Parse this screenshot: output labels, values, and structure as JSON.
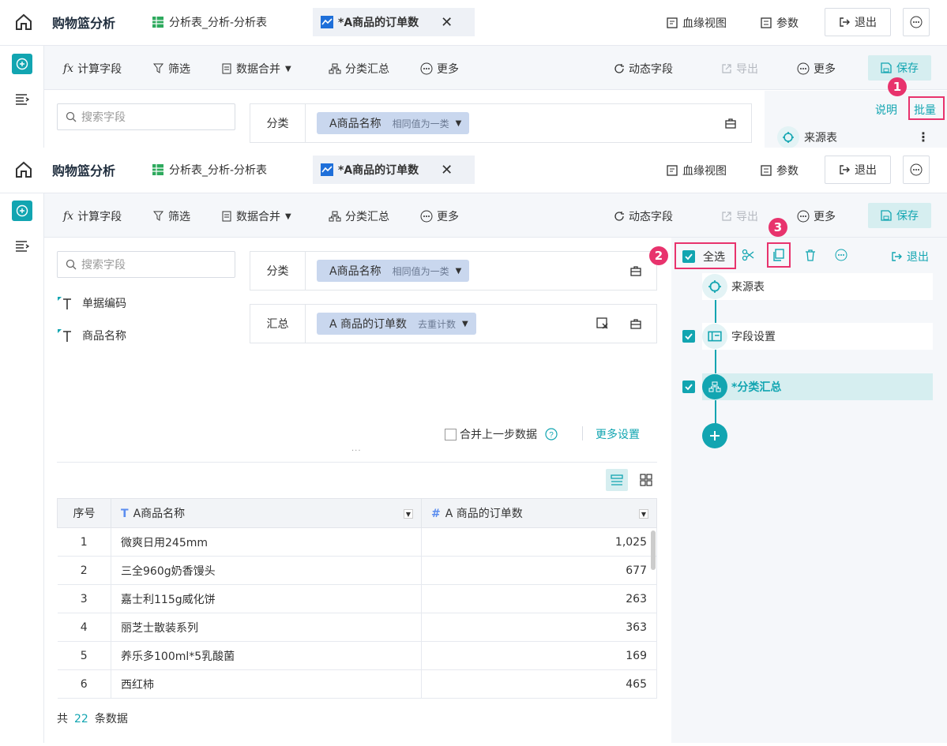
{
  "app": {
    "title": "购物篮分析",
    "tabs": [
      {
        "label": "分析表_分析-分析表"
      },
      {
        "label": "*A商品的订单数"
      }
    ],
    "top_actions": {
      "lineage": "血缘视图",
      "params": "参数",
      "exit": "退出"
    }
  },
  "toolbar": {
    "calc_field": "计算字段",
    "filter": "筛选",
    "merge": "数据合并",
    "group_summary": "分类汇总",
    "more_left": "更多",
    "dynamic_field": "动态字段",
    "export": "导出",
    "more_right": "更多",
    "save": "保存"
  },
  "back_view": {
    "explain": "说明",
    "batch": "批量",
    "source_table": "来源表",
    "pill_label": "A商品名称",
    "pill_sub": "相同值为一类",
    "category_label": "分类"
  },
  "left_panel": {
    "search_placeholder": "搜索字段",
    "fields": [
      "单据编码",
      "商品名称"
    ]
  },
  "config": {
    "category_label": "分类",
    "category_field": "A商品名称",
    "category_mode": "相同值为一类",
    "summary_label": "汇总",
    "summary_field": "A 商品的订单数",
    "summary_mode": "去重计数",
    "merge_prev": "合并上一步数据",
    "more_settings": "更多设置"
  },
  "table": {
    "headers": [
      "序号",
      "A商品名称",
      "A 商品的订单数"
    ],
    "rows": [
      {
        "idx": "1",
        "name": "微爽日用245mm",
        "count": "1,025"
      },
      {
        "idx": "2",
        "name": "三全960g奶香馒头",
        "count": "677"
      },
      {
        "idx": "3",
        "name": "嘉士利115g威化饼",
        "count": "263"
      },
      {
        "idx": "4",
        "name": "丽芝士散装系列",
        "count": "363"
      },
      {
        "idx": "5",
        "name": "养乐多100ml*5乳酸菌",
        "count": "169"
      },
      {
        "idx": "6",
        "name": "西红柿",
        "count": "465"
      }
    ],
    "total_prefix": "共",
    "total_count": "22",
    "total_suffix": "条数据"
  },
  "right_panel": {
    "select_all": "全选",
    "exit": "退出",
    "steps": [
      {
        "label": "来源表"
      },
      {
        "label": "字段设置"
      },
      {
        "label": "*分类汇总"
      }
    ]
  },
  "badges": [
    "1",
    "2",
    "3"
  ],
  "colors": {
    "accent": "#12a5b1",
    "highlight": "#e8336d",
    "pill": "#c9d7ee"
  }
}
